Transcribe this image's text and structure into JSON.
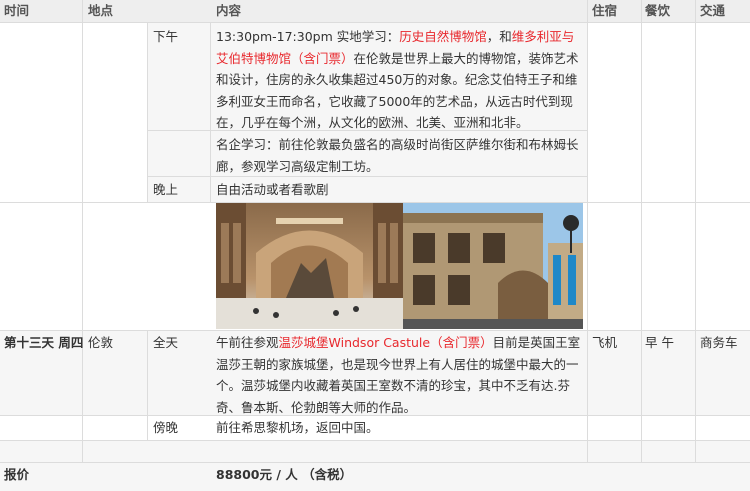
{
  "colors": {
    "accent_red": "#e8282d",
    "header_bg": "#eeeeee",
    "row_bg": "#f6f6f6"
  },
  "header": {
    "time": "时间",
    "place": "地点",
    "content": "内容",
    "lodging": "住宿",
    "meals": "餐饮",
    "transport": "交通"
  },
  "rows": {
    "afternoon": {
      "label": "下午",
      "p1": "13:30pm-17:30pm 实地学习：",
      "link1": "历史自然博物馆",
      "p2": "，和",
      "link2": "维多利亚与艾伯特博物馆（含门票）",
      "p3": "在伦敦是世界上最大的博物馆，装饰艺术和设计，住房的永久收集超过450万的对象。纪念艾伯特王子和维多利亚女王而命名，它收藏了5000年的艺术品，从远古时代到现在，几乎在每个洲，从文化的欧洲、北美、亚洲和北非。"
    },
    "brand": {
      "text": "名企学习：前往伦敦最负盛名的高级时尚街区萨维尔街和布林姆长廊，参观学习高级定制工坊。"
    },
    "evening": {
      "label": "晚上",
      "text": "自由活动或者看歌剧"
    },
    "day13": {
      "day": "第十三天 周四",
      "place": "伦敦",
      "period": "全天",
      "p1": "午前往参观",
      "link": "温莎城堡Windsor Castule（含门票）",
      "p2": "目前是英国王室温莎王朝的家族城堡，也是现今世界上有人居住的城堡中最大的一个。温莎城堡内收藏着英国王室数不清的珍宝，其中不乏有达.芬奇、鲁本斯、伦勃朗等大师的作品。",
      "lodging": "飞机",
      "meals": "早 午",
      "transport": "商务车"
    },
    "dusk": {
      "label": "傍晚",
      "text": "前往希思黎机场，返回中国。"
    },
    "price": {
      "label": "报价",
      "value": "88800元 / 人 （含税）"
    }
  }
}
